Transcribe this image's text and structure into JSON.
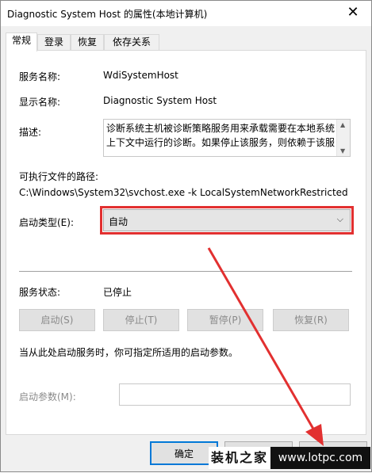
{
  "window": {
    "title": "Diagnostic System Host 的属性(本地计算机)"
  },
  "tabs": [
    {
      "label": "常规"
    },
    {
      "label": "登录"
    },
    {
      "label": "恢复"
    },
    {
      "label": "依存关系"
    }
  ],
  "general": {
    "service_name_label": "服务名称:",
    "service_name_value": "WdiSystemHost",
    "display_name_label": "显示名称:",
    "display_name_value": "Diagnostic System Host",
    "description_label": "描述:",
    "description_lines": [
      "诊断系统主机被诊断策略服务用来承载需要在本地系统",
      "上下文中运行的诊断。如果停止该服务，则依赖于该服"
    ],
    "exe_path_label": "可执行文件的路径:",
    "exe_path_value": "C:\\Windows\\System32\\svchost.exe -k LocalSystemNetworkRestricted",
    "startup_type_label": "启动类型(E):",
    "startup_type_value": "自动",
    "service_status_label": "服务状态:",
    "service_status_value": "已停止",
    "buttons": {
      "start": "启动(S)",
      "stop": "停止(T)",
      "pause": "暂停(P)",
      "resume": "恢复(R)"
    },
    "hint_text": "当从此处启动服务时，你可指定所适用的启动参数。",
    "start_params_label": "启动参数(M):",
    "start_params_value": ""
  },
  "footer": {
    "ok_label": "确定"
  },
  "watermark": {
    "left_text": "装机之家",
    "right_text": "www.lotpc.com"
  },
  "colors": {
    "annotation": "#e23030",
    "accent": "#0078d7"
  }
}
